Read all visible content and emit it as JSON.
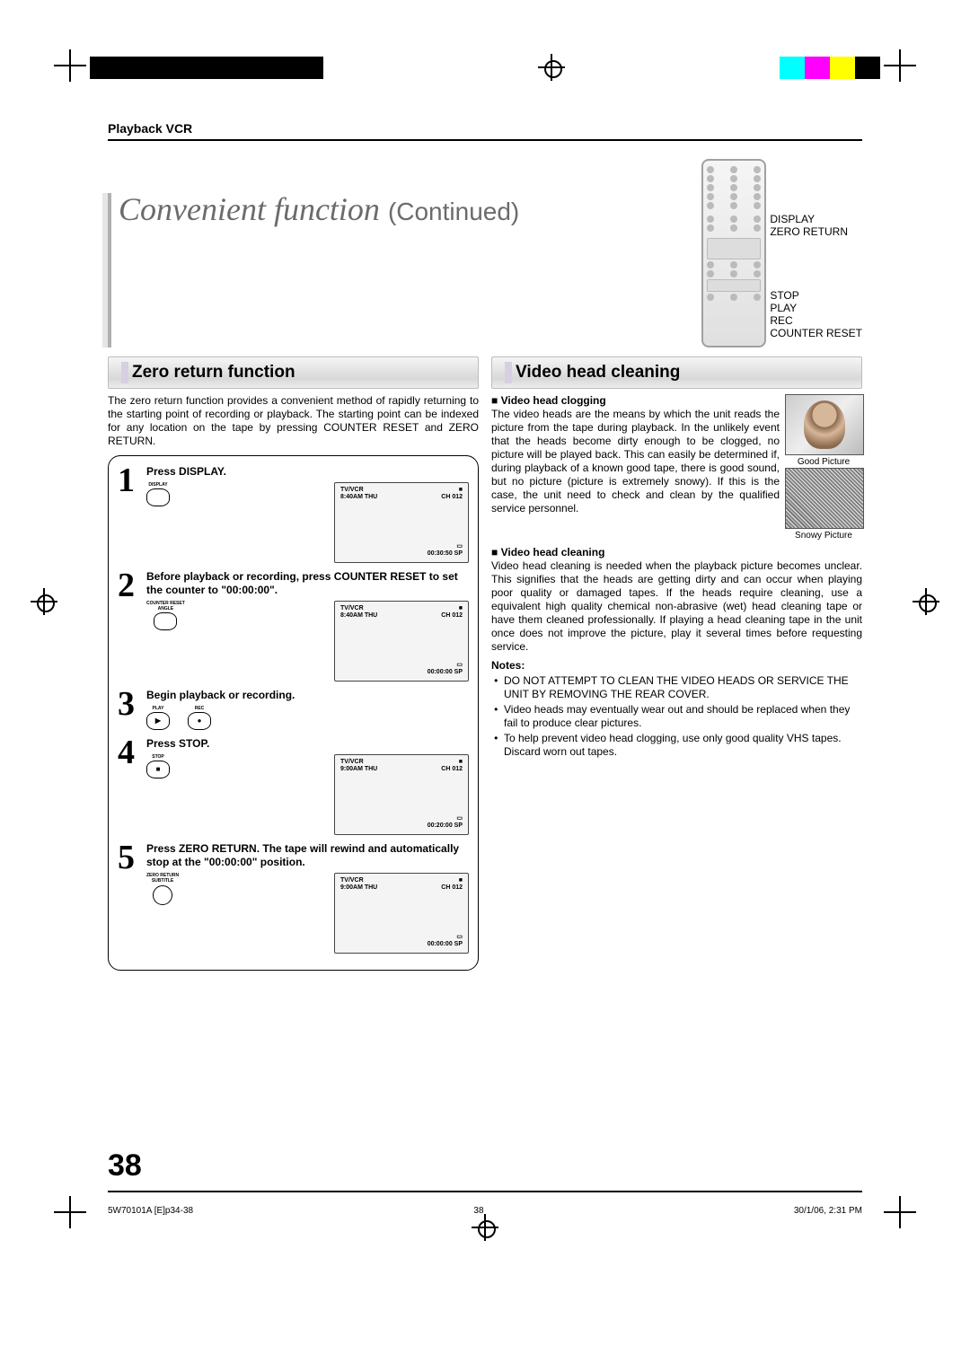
{
  "breadcrumb": "Playback VCR",
  "page_title_main": "Convenient function",
  "page_title_cont": "(Continued)",
  "remote_labels": {
    "display": "DISPLAY",
    "zero_return": "ZERO RETURN",
    "stop": "STOP",
    "play": "PLAY",
    "rec": "REC",
    "counter_reset": "COUNTER RESET"
  },
  "left": {
    "heading": "Zero return function",
    "intro": "The zero return function provides a convenient method of rapidly returning to the starting point of recording or playback. The starting point can be indexed for any location on the tape by pressing COUNTER RESET and ZERO RETURN.",
    "steps": [
      {
        "num": "1",
        "text": "Press DISPLAY.",
        "buttons": [
          {
            "label": "DISPLAY",
            "shape": "pill"
          }
        ],
        "osd": {
          "tv": "TV/VCR",
          "time": "8:40AM  THU",
          "ch": "CH 012",
          "counter": "00:30:50  SP",
          "icon": "■"
        }
      },
      {
        "num": "2",
        "text": "Before playback or recording, press COUNTER RESET to set the counter to \"00:00:00\".",
        "buttons": [
          {
            "label": "COUNTER RESET",
            "sub": "ANGLE",
            "shape": "pill"
          }
        ],
        "osd": {
          "tv": "TV/VCR",
          "time": "8:40AM  THU",
          "ch": "CH 012",
          "counter": "00:00:00  SP",
          "icon": "■"
        }
      },
      {
        "num": "3",
        "text": "Begin playback or recording.",
        "buttons": [
          {
            "label": "PLAY",
            "sym": "▶",
            "shape": "pill"
          },
          {
            "label": "REC",
            "sym": "●",
            "shape": "pill"
          }
        ]
      },
      {
        "num": "4",
        "text": "Press STOP.",
        "buttons": [
          {
            "label": "STOP",
            "sym": "■",
            "shape": "pill"
          }
        ],
        "osd": {
          "tv": "TV/VCR",
          "time": "9:00AM  THU",
          "ch": "CH 012",
          "counter": "00:20:00  SP",
          "icon": "■"
        }
      },
      {
        "num": "5",
        "text": "Press ZERO RETURN. The tape will rewind and automatically stop at the \"00:00:00\" position.",
        "buttons": [
          {
            "label": "ZERO RETURN",
            "sub": "SUBTITLE",
            "shape": "round"
          }
        ],
        "osd": {
          "tv": "TV/VCR",
          "time": "9:00AM  THU",
          "ch": "CH 012",
          "counter": "00:00:00  SP",
          "icon": "■"
        }
      }
    ]
  },
  "right": {
    "heading": "Video head cleaning",
    "clog_head": "Video head clogging",
    "clog_text": "The video heads are the means by which the unit reads the picture from the tape during playback. In the unlikely event that the heads become dirty enough to be clogged, no picture will be played back. This can easily be determined if, during playback of a known good tape, there is good sound, but no picture (picture is extremely snowy). If this is the case, the unit need to check and clean by the qualified service personnel.",
    "good_label": "Good Picture",
    "snowy_label": "Snowy Picture",
    "clean_head": "Video head cleaning",
    "clean_text": "Video head cleaning is needed when the playback picture becomes unclear. This signifies that the heads are getting dirty and can occur when playing poor quality or damaged tapes. If the heads require cleaning, use a equivalent high quality chemical non-abrasive (wet) head cleaning tape or have them cleaned professionally. If playing a head cleaning tape in the unit once does not improve the picture, play it several times before requesting service.",
    "notes_label": "Notes:",
    "notes": [
      "DO NOT ATTEMPT TO CLEAN THE VIDEO HEADS OR SERVICE THE UNIT BY REMOVING THE REAR COVER.",
      "Video heads may eventually wear out and should be replaced when they fail to produce clear pictures.",
      "To help prevent video head clogging, use only good quality VHS tapes. Discard worn out tapes."
    ]
  },
  "page_number": "38",
  "footer": {
    "left": "5W70101A [E]p34-38",
    "mid": "38",
    "right": "30/1/06, 2:31 PM"
  }
}
